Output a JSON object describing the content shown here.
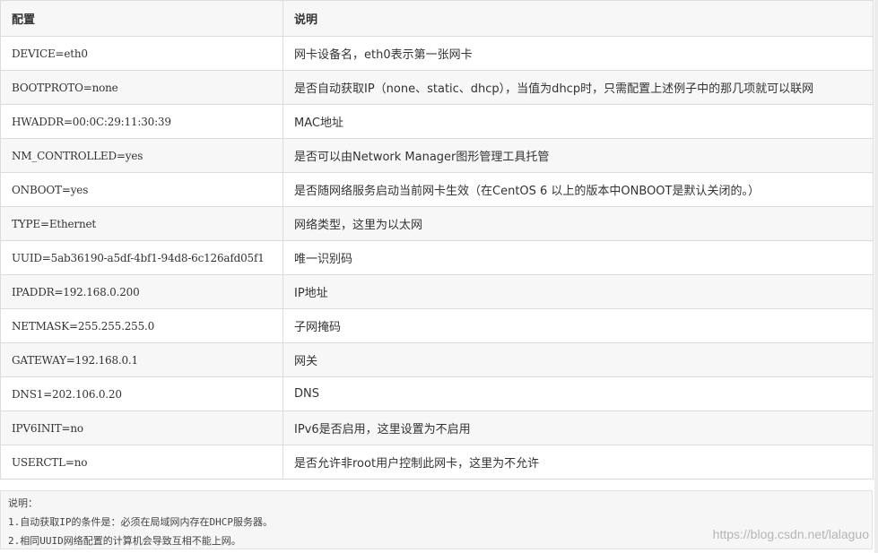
{
  "table": {
    "headers": [
      "配置",
      "说明"
    ],
    "rows": [
      {
        "key": "DEVICE=eth0",
        "desc": "网卡设备名，eth0表示第一张网卡"
      },
      {
        "key": "BOOTPROTO=none",
        "desc": "是否自动获取IP（none、static、dhcp），当值为dhcp时，只需配置上述例子中的那几项就可以联网"
      },
      {
        "key": "HWADDR=00:0C:29:11:30:39",
        "desc": "MAC地址"
      },
      {
        "key": "NM_CONTROLLED=yes",
        "desc": "是否可以由Network Manager图形管理工具托管"
      },
      {
        "key": "ONBOOT=yes",
        "desc": "是否随网络服务启动当前网卡生效（在CentOS 6 以上的版本中ONBOOT是默认关闭的。）"
      },
      {
        "key": "TYPE=Ethernet",
        "desc": "网络类型，这里为以太网"
      },
      {
        "key": "UUID=5ab36190-a5df-4bf1-94d8-6c126afd05f1",
        "desc": "唯一识别码"
      },
      {
        "key": "IPADDR=192.168.0.200",
        "desc": "IP地址"
      },
      {
        "key": "NETMASK=255.255.255.0",
        "desc": "子网掩码"
      },
      {
        "key": "GATEWAY=192.168.0.1",
        "desc": "网关"
      },
      {
        "key": "DNS1=202.106.0.20",
        "desc": "DNS"
      },
      {
        "key": "IPV6INIT=no",
        "desc": "IPv6是否启用，这里设置为不启用"
      },
      {
        "key": "USERCTL=no",
        "desc": "是否允许非root用户控制此网卡，这里为不允许"
      }
    ]
  },
  "notes": {
    "title": "说明：",
    "lines": [
      "1.自动获取IP的条件是：必须在局域网内存在DHCP服务器。",
      "2.相同UUID网络配置的计算机会导致互相不能上网。"
    ]
  },
  "watermark": "https://blog.csdn.net/lalaguo"
}
